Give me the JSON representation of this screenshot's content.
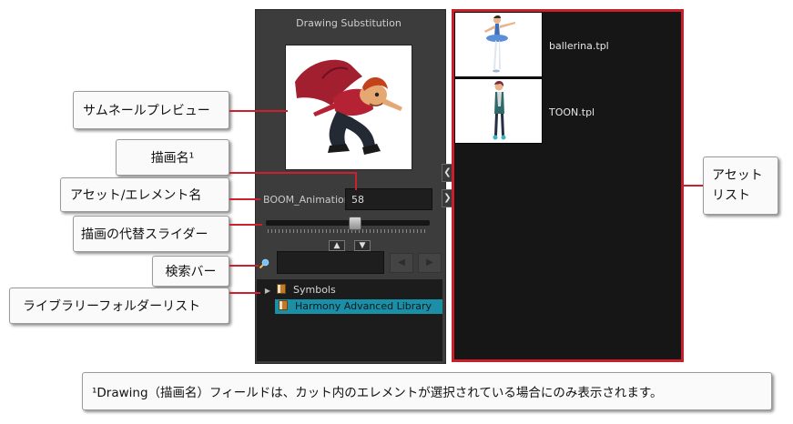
{
  "panel": {
    "title": "Drawing Substitution",
    "drawing_label": "BOOM_Animation",
    "drawing_value": "58",
    "slider_level_fraction": 0.55,
    "collapse_up_icon": "chevron-up-icon",
    "collapse_down_icon": "chevron-down-icon",
    "search_icon": "magnifier-icon",
    "search_value": "",
    "nav_prev_icon": "triangle-left-icon",
    "nav_next_icon": "triangle-right-icon",
    "tree": [
      {
        "label": "Symbols",
        "icon": "library-book-icon",
        "expandable": true,
        "selected": false
      },
      {
        "label": "Harmony Advanced Library",
        "icon": "library-book-icon",
        "expandable": false,
        "selected": true
      }
    ]
  },
  "side_arrows": {
    "left_icon": "chevron-left-icon",
    "right_icon": "chevron-right-icon"
  },
  "assets": [
    {
      "name": "ballerina.tpl"
    },
    {
      "name": "TOON.tpl"
    }
  ],
  "callouts": {
    "thumbnail_preview": "サムネールプレビュー",
    "drawing_name": "描画名¹",
    "asset_element_name": "アセット/エレメント名",
    "substitution_slider": "描画の代替スライダー",
    "search_bar": "検索バー",
    "library_folder_list": "ライブラリーフォルダーリスト",
    "asset_list_line1": "アセット",
    "asset_list_line2": "リスト",
    "footnote": "¹Drawing（描画名）フィールドは、カット内のエレメントが選択されている場合にのみ表示されます。"
  },
  "colors": {
    "accent_red": "#cc2030",
    "selection_teal": "#1b8fa6",
    "panel_bg": "#3c3c3c",
    "list_bg": "#161616"
  }
}
